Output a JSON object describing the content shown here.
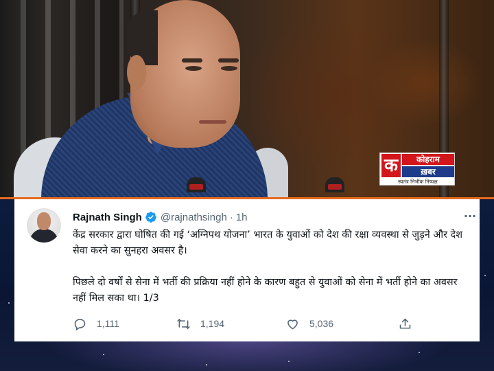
{
  "logo": {
    "letter": "क",
    "line1": "कोहराम",
    "line2": "ख़बर",
    "tagline": "स्वतंत्र निर्भीक निष्पक्ष"
  },
  "tweet": {
    "author_name": "Rajnath Singh",
    "handle": "@rajnathsingh",
    "separator": "·",
    "time": "1h",
    "paragraph1": "केंद्र सरकार द्वारा घोषित की गई ‘अग्निपथ योजना’ भारत के युवाओं को देश की रक्षा व्यवस्था से जुड़ने और देश सेवा करने का सुनहरा अवसर है।",
    "paragraph2": "पिछले दो वर्षों से सेना में भर्ती की प्रक्रिया नहीं होने के कारण बहुत से युवाओं को सेना में भर्ती होने का अवसर नहीं मिल सका था। 1/3",
    "replies": "1,111",
    "retweets": "1,194",
    "likes": "5,036",
    "more_label": "···"
  },
  "colors": {
    "verified": "#1d9bf0",
    "accent_strip": "#e86a1c",
    "logo_red": "#d3151c",
    "logo_blue": "#1e3a8a"
  },
  "icons": [
    "verified-badge-icon",
    "more-icon",
    "reply-icon",
    "retweet-icon",
    "like-icon",
    "share-icon"
  ]
}
